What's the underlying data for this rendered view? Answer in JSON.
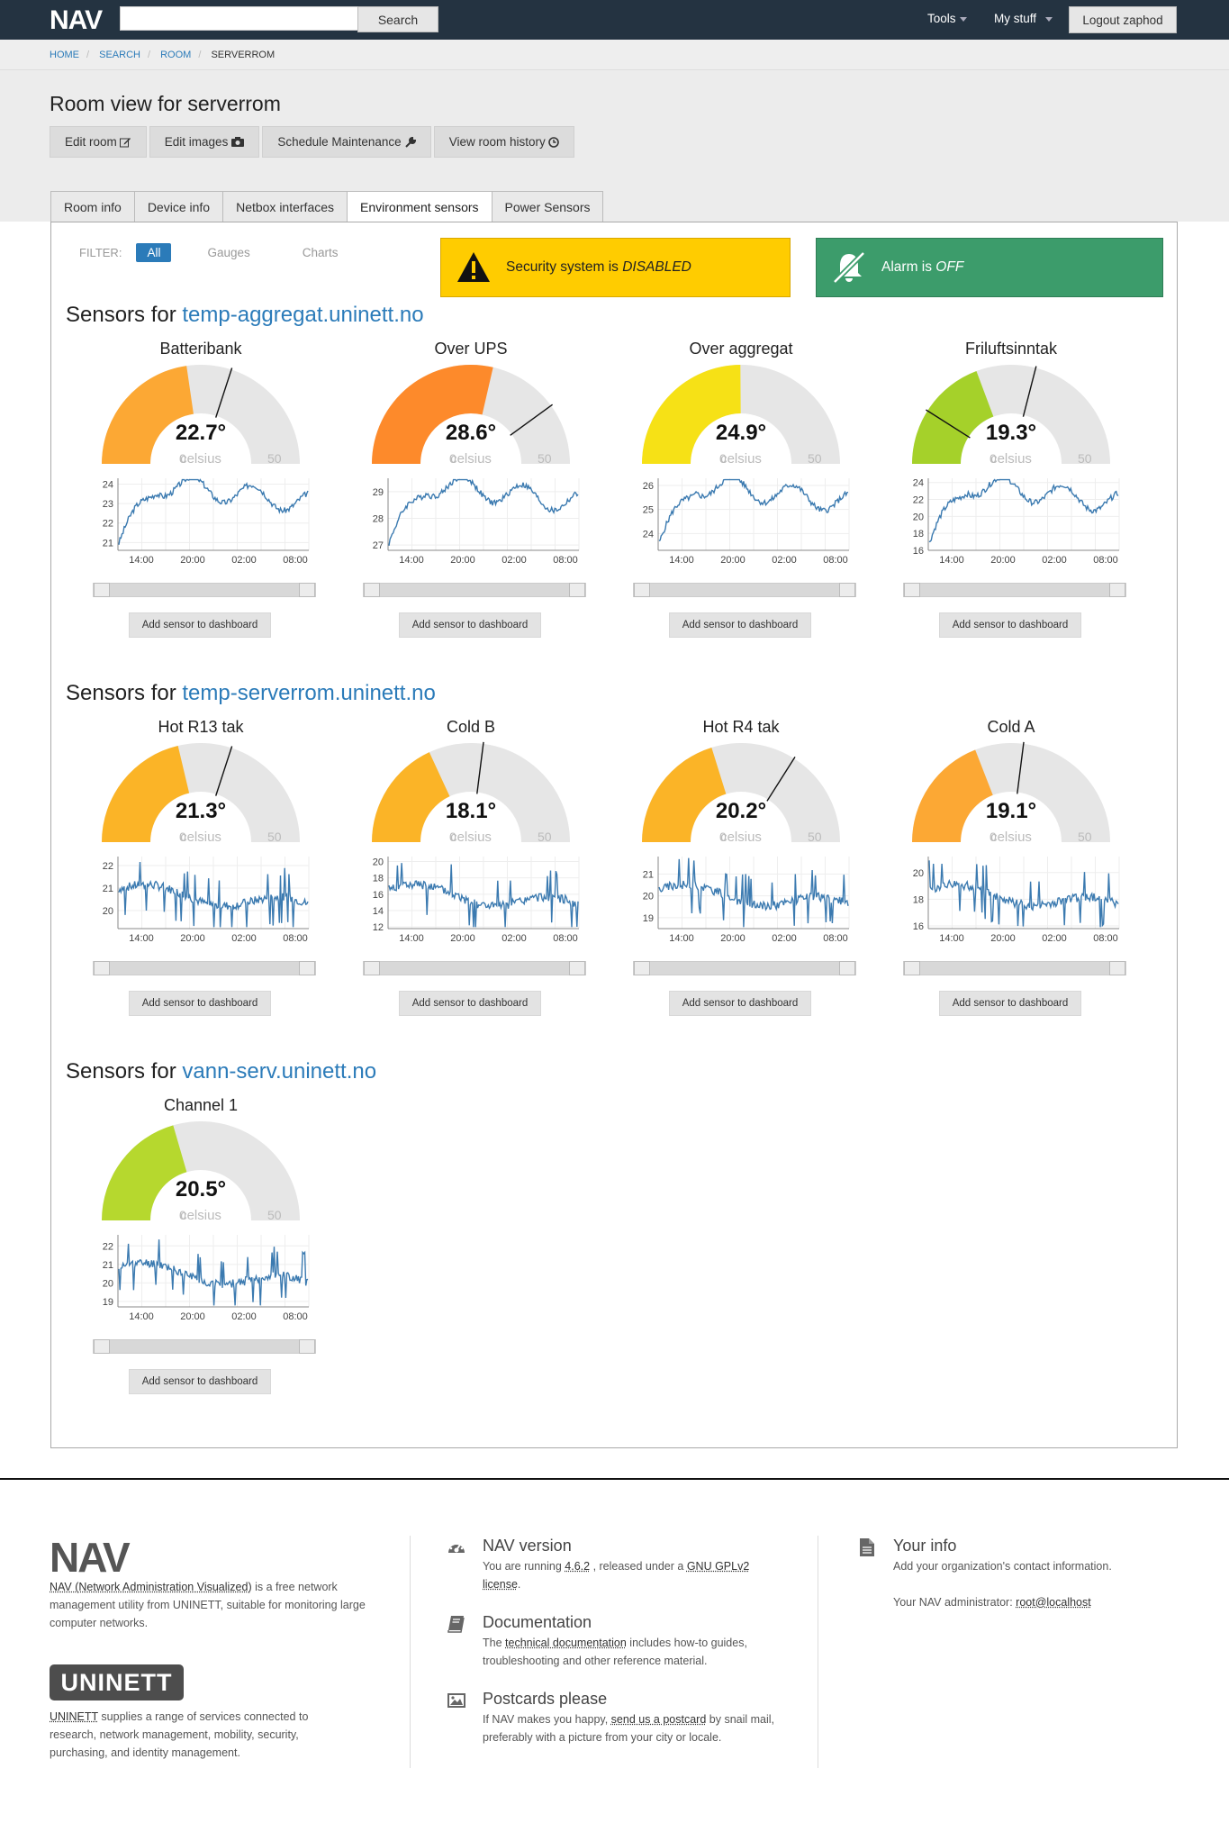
{
  "header": {
    "logo_text": "NAV",
    "search_placeholder": "",
    "search_button": "Search",
    "menu_tools": "Tools",
    "menu_mystuff": "My stuff",
    "logout": "Logout zaphod"
  },
  "breadcrumb": [
    "HOME",
    "SEARCH",
    "ROOM",
    "SERVERROM"
  ],
  "page_title": "Room view for serverrom",
  "actions": [
    "Edit room",
    "Edit images",
    "Schedule Maintenance",
    "View room history"
  ],
  "tabs": [
    "Room info",
    "Device info",
    "Netbox interfaces",
    "Environment sensors",
    "Power Sensors"
  ],
  "active_tab": "Environment sensors",
  "filter": {
    "label": "FILTER:",
    "options": [
      "All",
      "Gauges",
      "Charts"
    ],
    "active": "All"
  },
  "alerts": {
    "security_prefix": "Security system is ",
    "security_state": "DISABLED",
    "security_color": "#ffcc00",
    "alarm_prefix": "Alarm is ",
    "alarm_state": "OFF",
    "alarm_color": "#3c9c6b"
  },
  "sections": [
    {
      "prefix": "Sensors for ",
      "host": "temp-aggregat.uninett.no"
    },
    {
      "prefix": "Sensors for ",
      "host": "temp-serverrom.uninett.no"
    },
    {
      "prefix": "Sensors for ",
      "host": "vann-serv.uninett.no"
    }
  ],
  "gauge_common": {
    "unit": "celsius",
    "min": 0,
    "max": 50,
    "min_label": "0",
    "max_label": "50",
    "add_button": "Add sensor to dashboard"
  },
  "sensors": [
    {
      "name": "Batteribank",
      "value": 22.7,
      "display": "22.7°",
      "threshold": 30,
      "color": "#fca834",
      "yticks": [
        "24",
        "23",
        "22",
        "21"
      ],
      "ylim": [
        20.6,
        24.3
      ]
    },
    {
      "name": "Over UPS",
      "value": 28.6,
      "display": "28.6°",
      "threshold": 40,
      "color": "#fd8a2b",
      "yticks": [
        "29",
        "28",
        "27"
      ],
      "ylim": [
        26.8,
        29.5
      ]
    },
    {
      "name": "Over aggregat",
      "value": 24.9,
      "display": "24.9°",
      "threshold": null,
      "color": "#f6e116",
      "yticks": [
        "26",
        "25",
        "24"
      ],
      "ylim": [
        23.3,
        26.3
      ]
    },
    {
      "name": "Friluftsinntak",
      "value": 19.3,
      "display": "19.3°",
      "threshold": 29,
      "low_threshold": 9,
      "color": "#a5d12a",
      "yticks": [
        "24",
        "22",
        "20",
        "18",
        "16"
      ],
      "ylim": [
        16,
        24.5
      ]
    },
    {
      "name": "Hot R13 tak",
      "value": 21.3,
      "display": "21.3°",
      "threshold": 30,
      "color": "#fbb427",
      "yticks": [
        "22",
        "21",
        "20"
      ],
      "ylim": [
        19.2,
        22.4
      ]
    },
    {
      "name": "Cold B",
      "value": 18.1,
      "display": "18.1°",
      "threshold": 27,
      "color": "#fbb427",
      "yticks": [
        "20",
        "18",
        "16",
        "14",
        "12"
      ],
      "ylim": [
        11.8,
        20.6
      ]
    },
    {
      "name": "Hot R4 tak",
      "value": 20.2,
      "display": "20.2°",
      "threshold": 34,
      "color": "#fbb427",
      "yticks": [
        "21",
        "20",
        "19"
      ],
      "ylim": [
        18.5,
        21.8
      ]
    },
    {
      "name": "Cold A",
      "value": 19.1,
      "display": "19.1°",
      "threshold": 27,
      "color": "#fca834",
      "yticks": [
        "20",
        "18",
        "16"
      ],
      "ylim": [
        15.8,
        21.2
      ]
    },
    {
      "name": "Channel 1",
      "value": 20.5,
      "display": "20.5°",
      "threshold": null,
      "color": "#b6d82e",
      "yticks": [
        "22",
        "21",
        "20",
        "19"
      ],
      "ylim": [
        18.7,
        22.6
      ]
    }
  ],
  "chart_xticks": [
    "14:00",
    "20:00",
    "02:00",
    "08:00"
  ],
  "footer": {
    "about_link": "NAV (Network Administration Visualized)",
    "about_text": " is a free network management utility from UNINETT, suitable for monitoring large computer networks.",
    "uninett_logo": "UNINETT",
    "uninett_link": "UNINETT",
    "uninett_text": " supplies a range of services connected to research, network management, mobility, security, purchasing, and identity management.",
    "version_head": "NAV version",
    "version_pre": "You are running ",
    "version": "4.6.2",
    "version_mid": " , released under a ",
    "license_link": "GNU GPLv2 license",
    "version_end": ".",
    "doc_head": "Documentation",
    "doc_pre": "The ",
    "doc_link": "technical documentation",
    "doc_text": " includes how-to guides, troubleshooting and other reference material.",
    "post_head": "Postcards please",
    "post_pre": "If NAV makes you happy, ",
    "post_link": "send us a postcard",
    "post_text": " by snail mail, preferably with a picture from your city or locale.",
    "info_head": "Your info",
    "info_text": "Add your organization's contact information.",
    "admin_pre": "Your NAV administrator: ",
    "admin_link": "root@localhost"
  }
}
